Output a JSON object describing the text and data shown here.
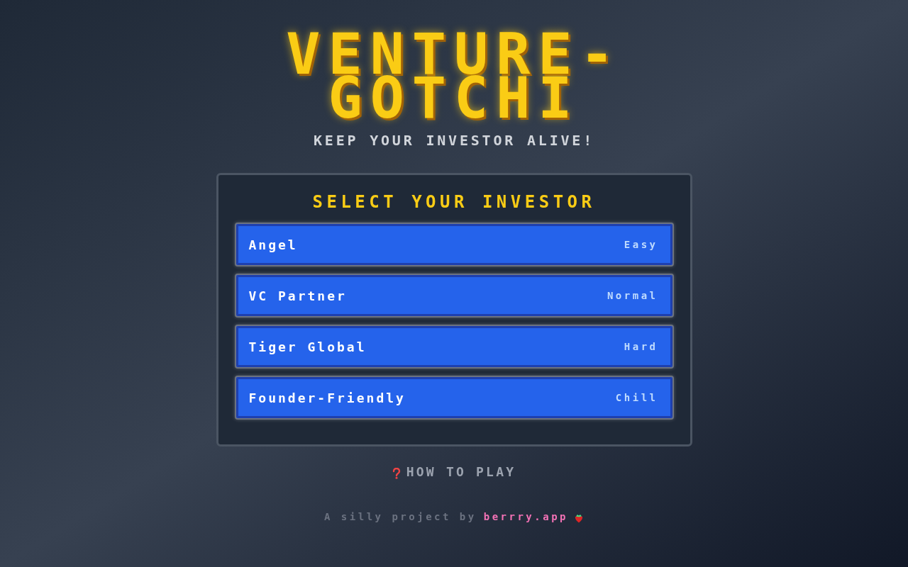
{
  "title": "VENTURE-GOTCHI",
  "subtitle": "KEEP YOUR INVESTOR ALIVE!",
  "panel": {
    "heading": "SELECT YOUR INVESTOR",
    "investors": [
      {
        "name": "Angel",
        "difficulty": "Easy"
      },
      {
        "name": "VC Partner",
        "difficulty": "Normal"
      },
      {
        "name": "Tiger Global",
        "difficulty": "Hard"
      },
      {
        "name": "Founder-Friendly",
        "difficulty": "Chill"
      }
    ]
  },
  "help_link": {
    "label": "HOW TO PLAY"
  },
  "footer": {
    "text": "A silly project by",
    "link": "berrry.app"
  }
}
